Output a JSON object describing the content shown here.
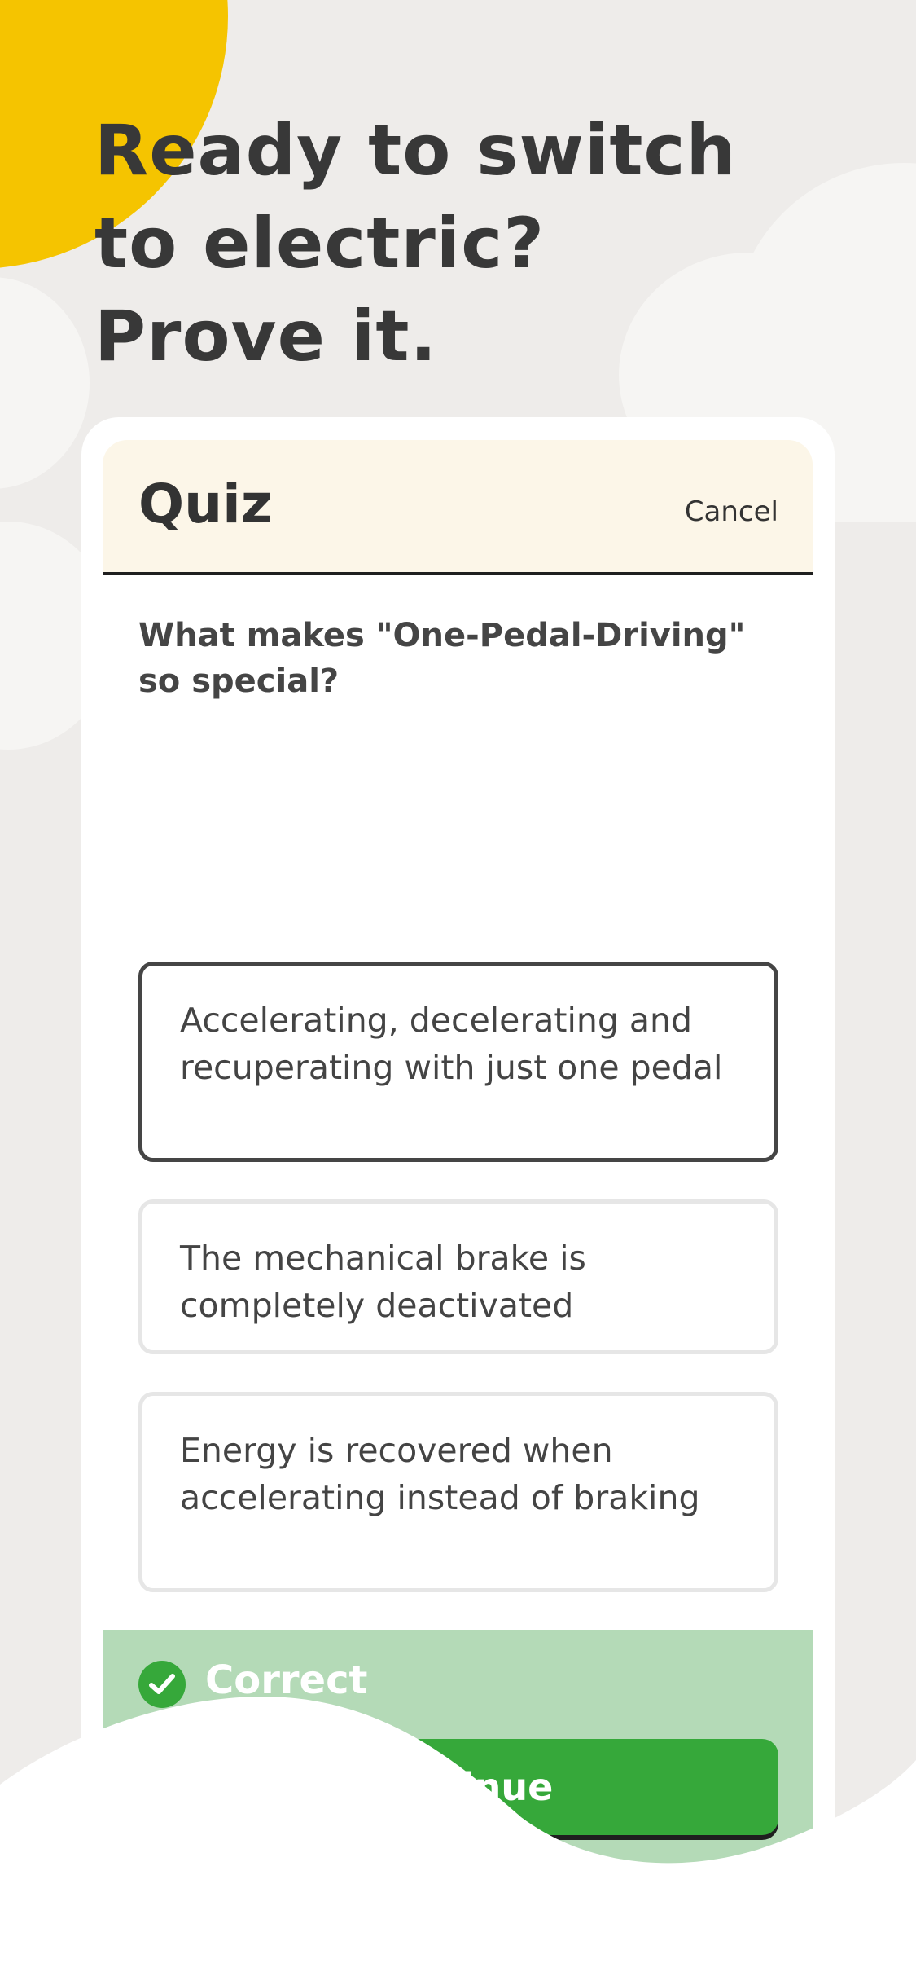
{
  "headline": {
    "line1": "Ready to switch",
    "line2": "to electric?",
    "line3": "Prove it."
  },
  "quiz": {
    "title": "Quiz",
    "cancel_label": "Cancel",
    "question": "What makes \"One-Pedal-Driving\" so special?",
    "options": [
      {
        "label": "Accelerating, decelerating and recuperating with just one pedal",
        "selected": true
      },
      {
        "label": "The mechanical brake is completely deactivated",
        "selected": false
      },
      {
        "label": "Energy is recovered when accelerating instead of braking",
        "selected": false
      }
    ],
    "feedback_label": "Correct",
    "continue_label": "Continue"
  },
  "colors": {
    "sun": "#f5c400",
    "header_bg": "#fcf6e8",
    "success_bg": "#b4dab7",
    "success_green": "#36a83a"
  },
  "icons": {
    "feedback": "check-circle-icon"
  }
}
